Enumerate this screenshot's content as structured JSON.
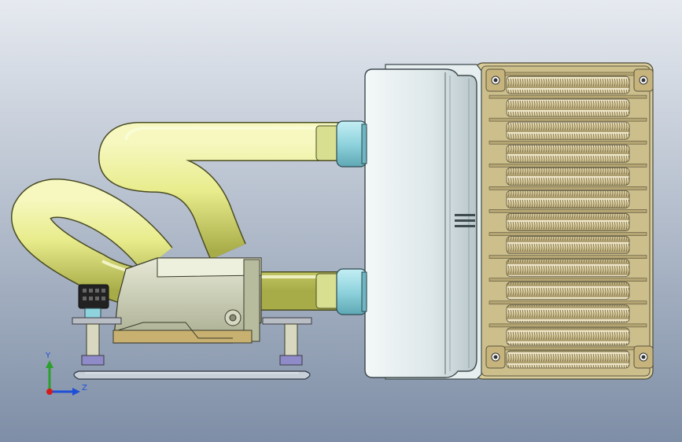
{
  "viewport": {
    "background_top": "#e6eaf0",
    "background_bottom": "#7e8ea6"
  },
  "colors": {
    "tube": "#e8ec8c",
    "tube_shadow": "#b8bc56",
    "fitting": "#8fd3dd",
    "body": "#dfe8ea",
    "fin": "#e2d6a8",
    "fin_dark": "#8a7a4a",
    "frame": "#cdbf8c",
    "pump": "#c8ccb0",
    "plate": "#c7cfd8",
    "bracket": "#b9bdc4"
  },
  "model": {
    "parts": [
      "radiator-end-tank",
      "radiator-core",
      "pump-block",
      "mounting-bracket",
      "upper-tube",
      "lower-tube",
      "fan-connector"
    ],
    "fin_rows": 13
  },
  "triad": {
    "y_label": "Y",
    "z_label": "Z",
    "x_color": "#d61a1a",
    "y_color": "#2ca02c",
    "z_color": "#1f4fd6"
  }
}
